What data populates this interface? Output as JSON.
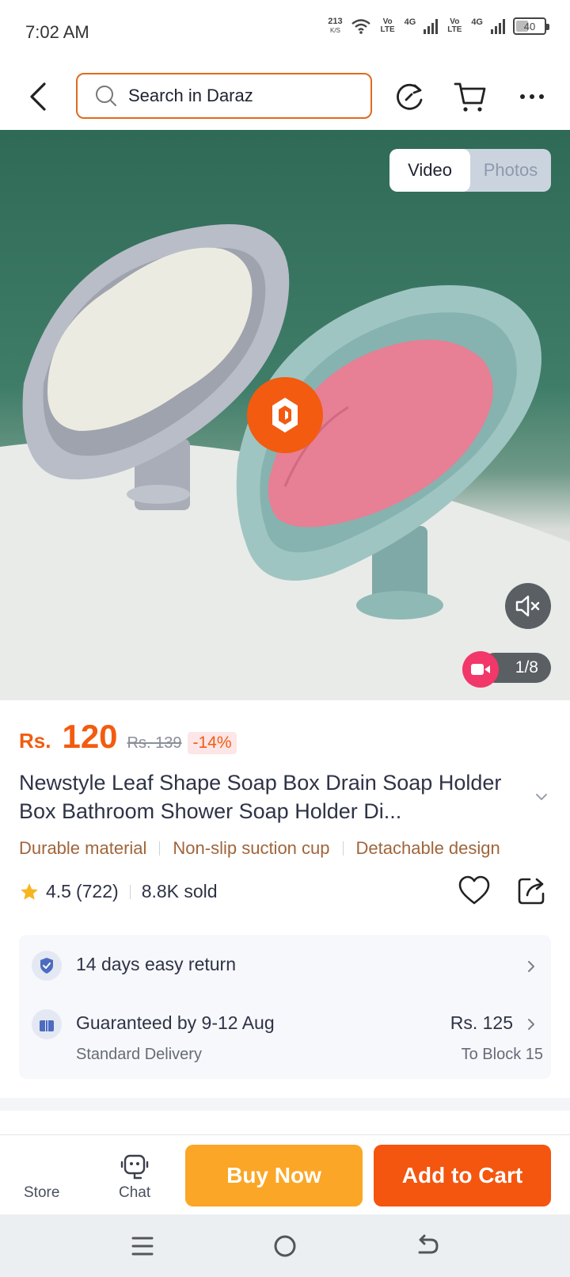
{
  "status_bar": {
    "time": "7:02 AM",
    "speed_value": "213",
    "speed_unit": "K/S",
    "volte_1": "Vo LTE",
    "net_1": "4G",
    "volte_2": "Vo LTE",
    "net_2": "4G",
    "battery": "40"
  },
  "header": {
    "search_placeholder": "Search in Daraz",
    "icons": [
      "back-icon",
      "search-icon",
      "refresh-icon",
      "cart-icon",
      "more-icon"
    ]
  },
  "media": {
    "tabs": [
      {
        "label": "Video",
        "active": true
      },
      {
        "label": "Photos",
        "active": false
      }
    ],
    "counter": "1/8",
    "icons": [
      "daraz-play-icon",
      "mute-icon",
      "video-badge-icon"
    ]
  },
  "product": {
    "currency": "Rs.",
    "price": "120",
    "old_price": "Rs. 139",
    "discount": "-14%",
    "title": "Newstyle Leaf Shape Soap Box Drain Soap Holder Box Bathroom Shower Soap Holder Di...",
    "tags": [
      "Durable material",
      "Non-slip suction cup",
      "Detachable design"
    ],
    "rating": "4.5",
    "reviews": "(722)",
    "sold": "8.8K sold"
  },
  "services": {
    "return_label": "14 days easy return",
    "delivery_label": "Guaranteed by 9-12 Aug",
    "delivery_type": "Standard Delivery",
    "delivery_fee": "Rs. 125",
    "delivery_location": "To Block 15"
  },
  "bottom_bar": {
    "store_label": "Store",
    "chat_label": "Chat",
    "buy_now_label": "Buy Now",
    "add_to_cart_label": "Add to Cart"
  },
  "colors": {
    "accent": "#f35b10",
    "buy_now": "#fba626",
    "add_to_cart": "#f4550f",
    "tag_text": "#a0653b"
  }
}
